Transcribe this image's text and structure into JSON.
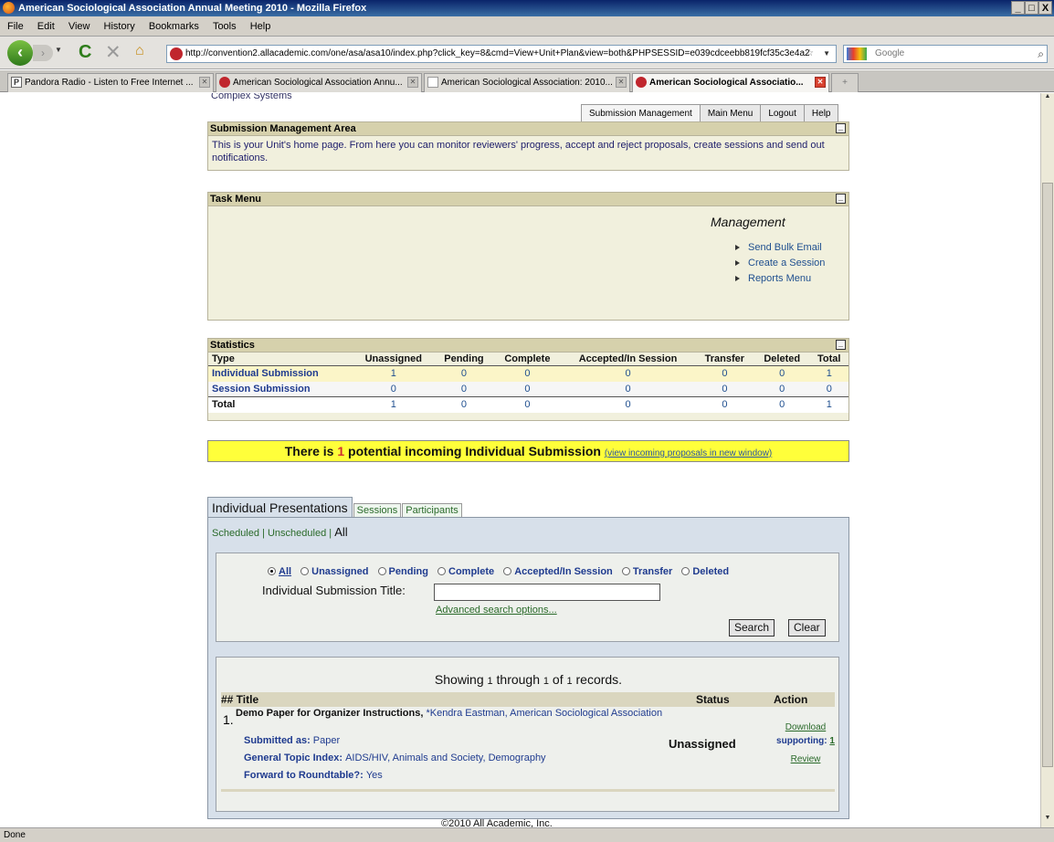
{
  "window": {
    "title": "American Sociological Association Annual Meeting 2010 - Mozilla Firefox",
    "controls": [
      "_",
      "□",
      "X"
    ]
  },
  "menubar": [
    "File",
    "Edit",
    "View",
    "History",
    "Bookmarks",
    "Tools",
    "Help"
  ],
  "url": "http://convention2.allacademic.com/one/asa/asa10/index.php?click_key=8&cmd=View+Unit+Plan&view=both&PHPSESSID=e039cdceebb819fcf35c3e4a2",
  "search_placeholder": "Google",
  "tabs": [
    {
      "label": "Pandora Radio - Listen to Free Internet ..."
    },
    {
      "label": "American Sociological Association Annu..."
    },
    {
      "label": "American Sociological Association: 2010..."
    },
    {
      "label": "American Sociological Associatio..."
    }
  ],
  "status": "Done",
  "page": {
    "unit_name": "Complex Systems",
    "top_nav": [
      "Submission Management",
      "Main Menu",
      "Logout",
      "Help"
    ],
    "sma": {
      "title": "Submission Management Area",
      "text": "This is your Unit's home page. From here you can monitor reviewers' progress, accept and reject proposals, create sessions and send out notifications."
    },
    "task_menu": {
      "title": "Task Menu",
      "heading": "Management",
      "links": [
        "Send Bulk Email",
        "Create a Session",
        "Reports Menu"
      ]
    },
    "statistics": {
      "title": "Statistics",
      "columns": [
        "Type",
        "Unassigned",
        "Pending",
        "Complete",
        "Accepted/In Session",
        "Transfer",
        "Deleted",
        "Total"
      ],
      "rows": [
        {
          "label": "Individual Submission",
          "values": [
            "1",
            "0",
            "0",
            "0",
            "0",
            "0",
            "1"
          ]
        },
        {
          "label": "Session Submission",
          "values": [
            "0",
            "0",
            "0",
            "0",
            "0",
            "0",
            "0"
          ]
        },
        {
          "label": "Total",
          "values": [
            "1",
            "0",
            "0",
            "0",
            "0",
            "0",
            "1"
          ]
        }
      ]
    },
    "alert": {
      "prefix": "There is",
      "count": "1",
      "suffix": "potential incoming Individual Submission",
      "link": "(view incoming proposals in new window)"
    },
    "presentations": {
      "tabs": [
        "Individual Presentations",
        "Sessions",
        "Participants"
      ],
      "filter_scheduled": "Scheduled",
      "filter_unscheduled": "Unscheduled",
      "filter_all": "All",
      "separator": "|",
      "radios": [
        "All",
        "Unassigned",
        "Pending",
        "Complete",
        "Accepted/In Session",
        "Transfer",
        "Deleted"
      ],
      "title_label": "Individual Submission Title:",
      "title_value": "",
      "advanced": "Advanced search options...",
      "search_btn": "Search",
      "clear_btn": "Clear",
      "showing": {
        "pre": "Showing",
        "from": "1",
        "mid": "through",
        "to": "1",
        "of": "of",
        "total": "1",
        "post": "records."
      },
      "headers": {
        "title": "## Title",
        "status": "Status",
        "action": "Action"
      },
      "record": {
        "num": "1.",
        "title": "Demo Paper for Organizer Instructions",
        "author": "*Kendra Eastman, American Sociological Association",
        "submitted_as_label": "Submitted as:",
        "submitted_as": "Paper",
        "topic_label": "General Topic Index:",
        "topic": "AIDS/HIV, Animals and Society, Demography",
        "forward_label": "Forward to Roundtable?:",
        "forward": "Yes",
        "status": "Unassigned",
        "download": "Download",
        "supporting_label": "supporting:",
        "supporting_count": "1",
        "review": "Review"
      }
    },
    "footer": "©2010 All Academic, Inc."
  }
}
